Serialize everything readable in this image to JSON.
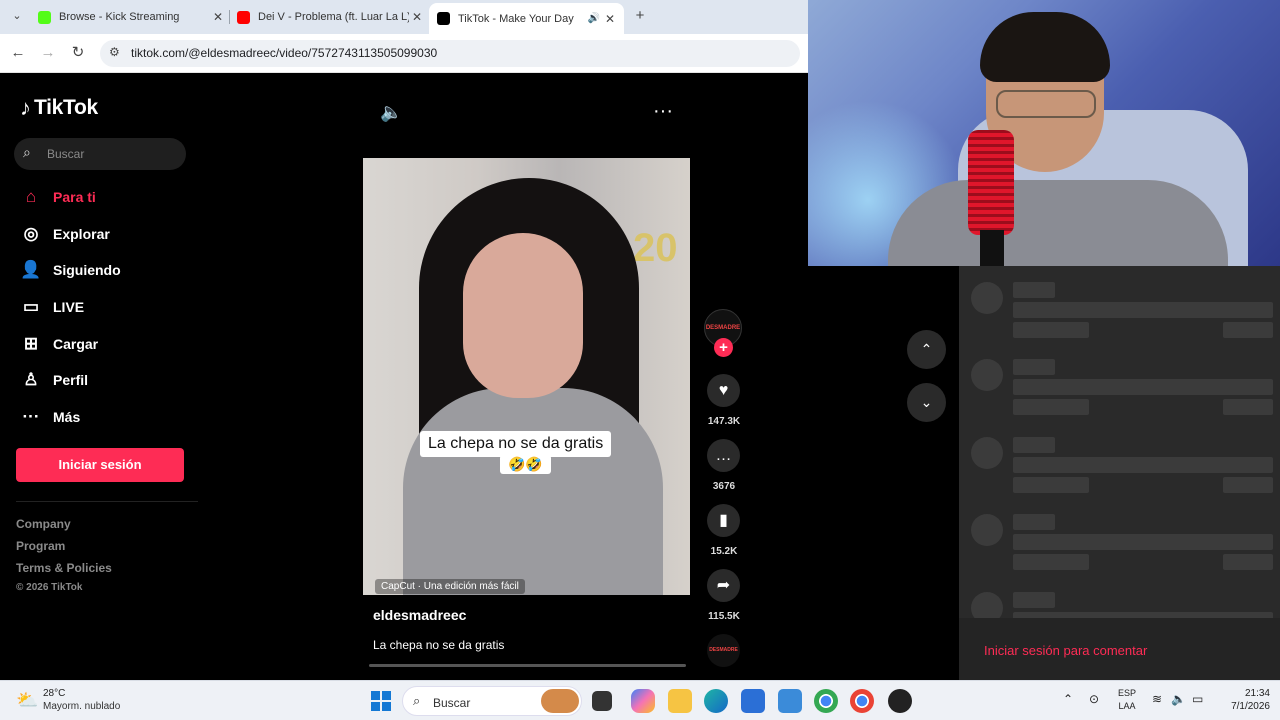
{
  "browser": {
    "tabs": [
      {
        "title": "Browse - Kick Streaming",
        "favicon_color": "#53fc18"
      },
      {
        "title": "Dei V - Problema (ft. Luar La L)",
        "favicon_color": "#ff0000"
      },
      {
        "title": "TikTok - Make Your Day",
        "favicon_color": "#000000"
      }
    ],
    "url": "tiktok.com/@eldesmadreec/video/7572743113505099030"
  },
  "tiktok": {
    "logo": "TikTok",
    "search_placeholder": "Buscar",
    "nav": [
      {
        "label": "Para ti",
        "icon": "home-icon"
      },
      {
        "label": "Explorar",
        "icon": "compass-icon"
      },
      {
        "label": "Siguiendo",
        "icon": "following-icon"
      },
      {
        "label": "LIVE",
        "icon": "live-icon"
      },
      {
        "label": "Cargar",
        "icon": "upload-icon"
      },
      {
        "label": "Perfil",
        "icon": "profile-icon"
      },
      {
        "label": "Más",
        "icon": "more-icon"
      }
    ],
    "login_button": "Iniciar sesión",
    "footer_links": [
      "Company",
      "Program",
      "Terms & Policies"
    ],
    "copyright": "© 2026 TikTok",
    "video": {
      "caption_line1": "La chepa no se da gratis",
      "caption_line2": "🤣🤣",
      "watermark": "CapCut · Una edición más fácil",
      "author": "eldesmadreec",
      "description": "La chepa no se da gratis",
      "avatar_text": "DESMADRE",
      "balloon_text": "20"
    },
    "actions": {
      "likes": "147.3K",
      "comments": "3676",
      "saves": "15.2K",
      "shares": "115.5K"
    },
    "comment_login": "Iniciar sesión para comentar"
  },
  "taskbar": {
    "weather_temp": "28°C",
    "weather_desc": "Mayorm. nublado",
    "search_placeholder": "Buscar",
    "lang_top": "ESP",
    "lang_bottom": "LAA",
    "time": "21:34",
    "date": "7/1/2026"
  }
}
